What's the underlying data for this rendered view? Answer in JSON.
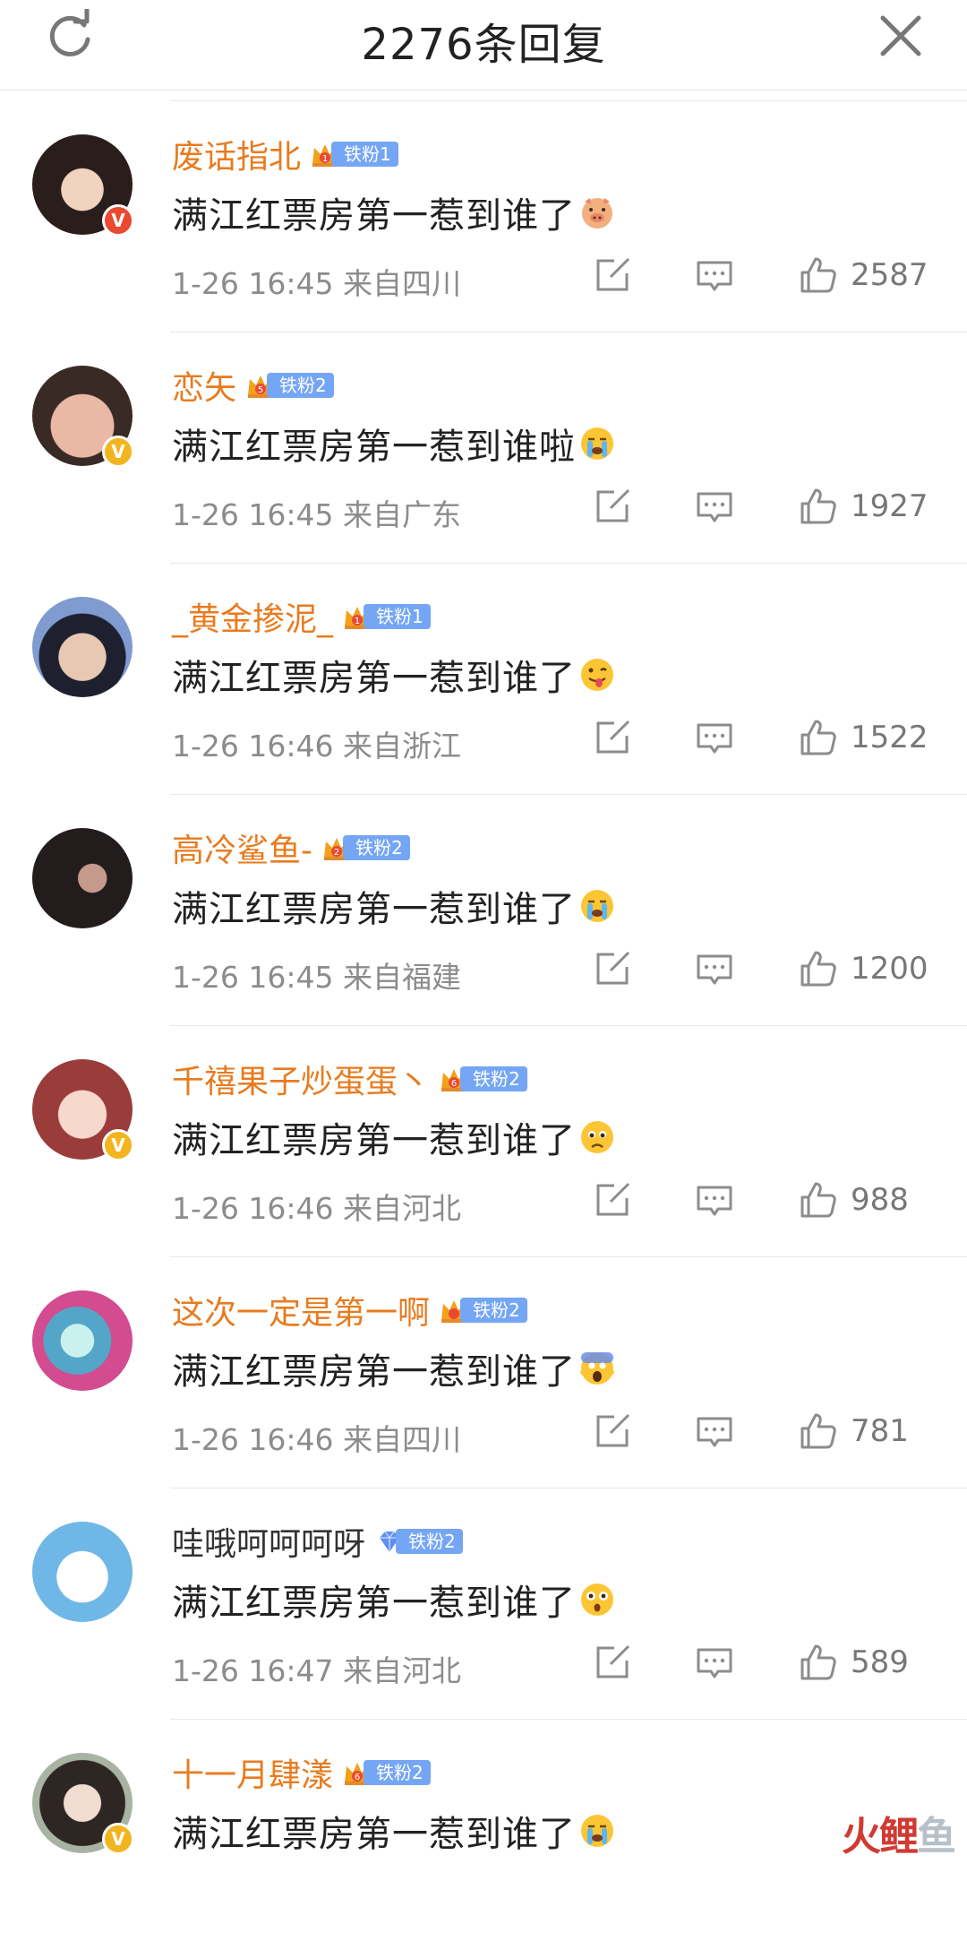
{
  "header": {
    "title": "2276条回复",
    "refresh_icon": "refresh-icon",
    "close_icon": "close-icon"
  },
  "comments": [
    {
      "username": "废话指北",
      "name_color": "orange",
      "fan_label": "铁粉1",
      "fan_level": "1",
      "fan_badge_type": "crown",
      "verified": "red",
      "text": "满江红票房第一惹到谁了",
      "emoji": "pig-emoji",
      "time": "1-26 16:45",
      "location": "来自四川",
      "likes": "2587"
    },
    {
      "username": "恋矢",
      "name_color": "orange",
      "fan_label": "铁粉2",
      "fan_level": "5",
      "fan_badge_type": "crown",
      "verified": "gold",
      "text": "满江红票房第一惹到谁啦",
      "emoji": "crying-emoji",
      "time": "1-26 16:45",
      "location": "来自广东",
      "likes": "1927"
    },
    {
      "username": "_黄金掺泥_",
      "name_color": "orange",
      "fan_label": "铁粉1",
      "fan_level": "1",
      "fan_badge_type": "crown",
      "verified": "",
      "text": "满江红票房第一惹到谁了",
      "emoji": "tongue-emoji",
      "time": "1-26 16:46",
      "location": "来自浙江",
      "likes": "1522"
    },
    {
      "username": "高冷鲨鱼-",
      "name_color": "orange",
      "fan_label": "铁粉2",
      "fan_level": "2",
      "fan_badge_type": "crown",
      "verified": "",
      "text": "满江红票房第一惹到谁了",
      "emoji": "crying-emoji",
      "time": "1-26 16:45",
      "location": "来自福建",
      "likes": "1200"
    },
    {
      "username": "千禧果子炒蛋蛋丶",
      "name_color": "orange",
      "fan_label": "铁粉2",
      "fan_level": "6",
      "fan_badge_type": "crown",
      "verified": "gold",
      "text": "满江红票房第一惹到谁了",
      "emoji": "sad-emoji",
      "time": "1-26 16:46",
      "location": "来自河北",
      "likes": "988"
    },
    {
      "username": "这次一定是第一啊",
      "name_color": "orange",
      "fan_label": "铁粉2",
      "fan_level": "",
      "fan_badge_type": "crown",
      "verified": "",
      "text": "满江红票房第一惹到谁了",
      "emoji": "scream-emoji",
      "time": "1-26 16:46",
      "location": "来自四川",
      "likes": "781"
    },
    {
      "username": "哇哦呵呵呵呀",
      "name_color": "gray",
      "fan_label": "铁粉2",
      "fan_level": "",
      "fan_badge_type": "diamond",
      "verified": "",
      "text": "满江红票房第一惹到谁了",
      "emoji": "shocked-emoji",
      "time": "1-26 16:47",
      "location": "来自河北",
      "likes": "589"
    },
    {
      "username": "十一月肆漾",
      "name_color": "orange",
      "fan_label": "铁粉2",
      "fan_level": "6",
      "fan_badge_type": "crown",
      "verified": "gold",
      "text": "满江红票房第一惹到谁了",
      "emoji": "crying-emoji",
      "time": "",
      "location": "",
      "likes": ""
    }
  ],
  "colors": {
    "username": "#e87b1f",
    "fan_badge": "#75a6f5",
    "verified_red": "#e8492f",
    "verified_gold": "#f3b51f",
    "meta": "#8c8c8c"
  },
  "watermark": {
    "text_red": "火鲤",
    "text_gray": "鱼"
  }
}
